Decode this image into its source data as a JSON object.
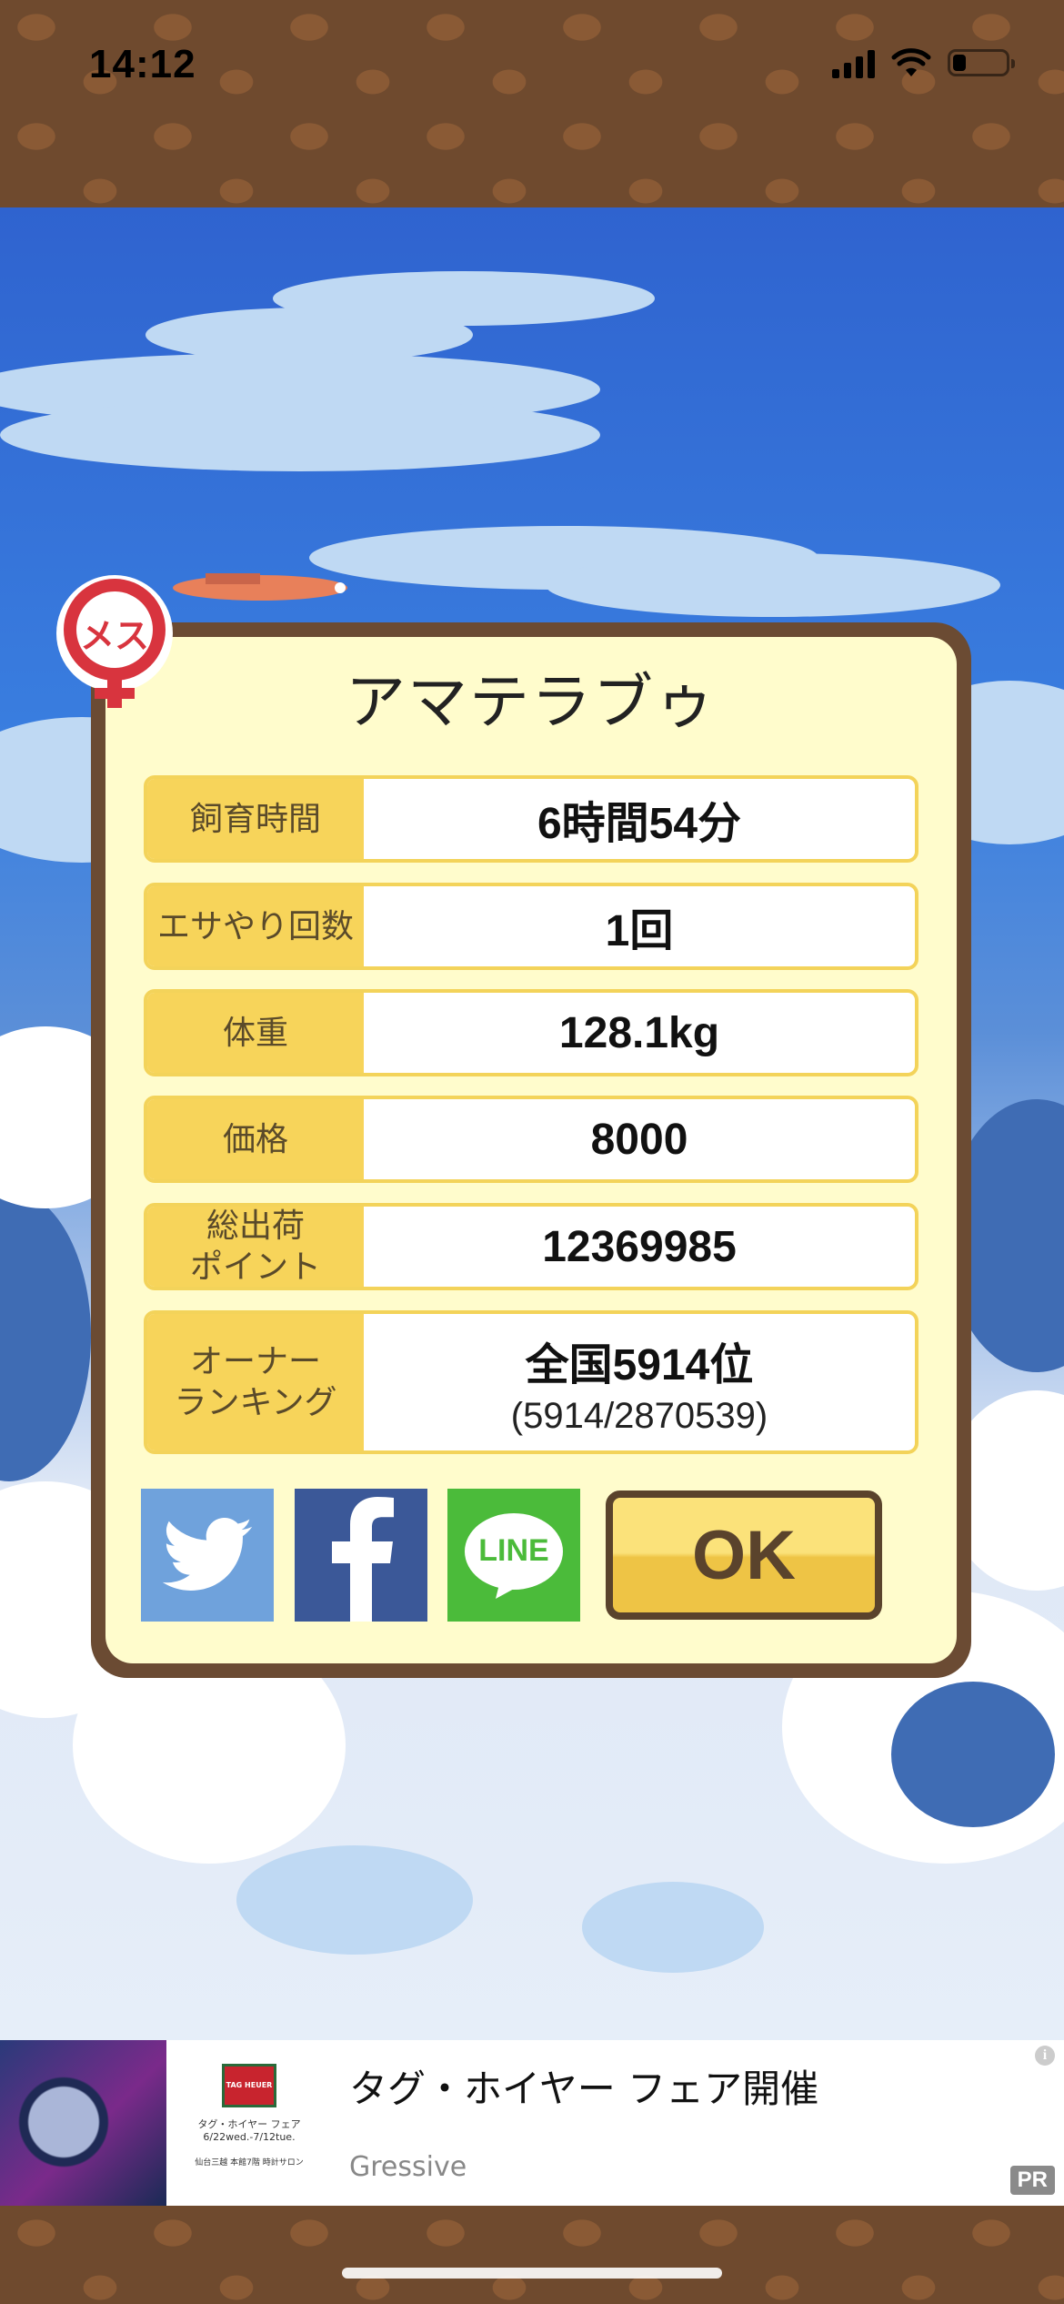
{
  "status_bar": {
    "time": "14:12"
  },
  "dialog": {
    "pet_name": "アマテラブゥ",
    "stats": [
      {
        "label": "飼育時間",
        "value": "6時間54分"
      },
      {
        "label": "エサやり回数",
        "value": "1回"
      },
      {
        "label": "体重",
        "value": "128.1kg"
      },
      {
        "label": "価格",
        "value": "8000"
      },
      {
        "label": "総出荷\nポイント",
        "value": "12369985"
      },
      {
        "label": "オーナー\nランキング",
        "value": "全国5914位",
        "sub": "(5914/2870539)"
      }
    ],
    "share": {
      "twitter_icon": "twitter-bird-icon",
      "facebook_icon": "facebook-f-icon",
      "line_label": "LINE"
    },
    "ok_label": "OK",
    "badge_text": "メス",
    "colors": {
      "panel_border": "#6b4b33",
      "panel_bg": "#fffccc",
      "label_bg": "#f7d45a",
      "twitter": "#6fa2dc",
      "facebook": "#3b5898",
      "line": "#4bbb3a"
    }
  },
  "ad": {
    "title": "タグ・ホイヤー フェア開催",
    "advertiser": "Gressive",
    "brand": "TAG HEUER",
    "fair_line": "タグ・ホイヤー フェア",
    "dates": "6/22wed.-7/12tue.",
    "venue": "仙台三越 本館7階 時計サロン",
    "pr_label": "PR",
    "info_icon": "i"
  }
}
